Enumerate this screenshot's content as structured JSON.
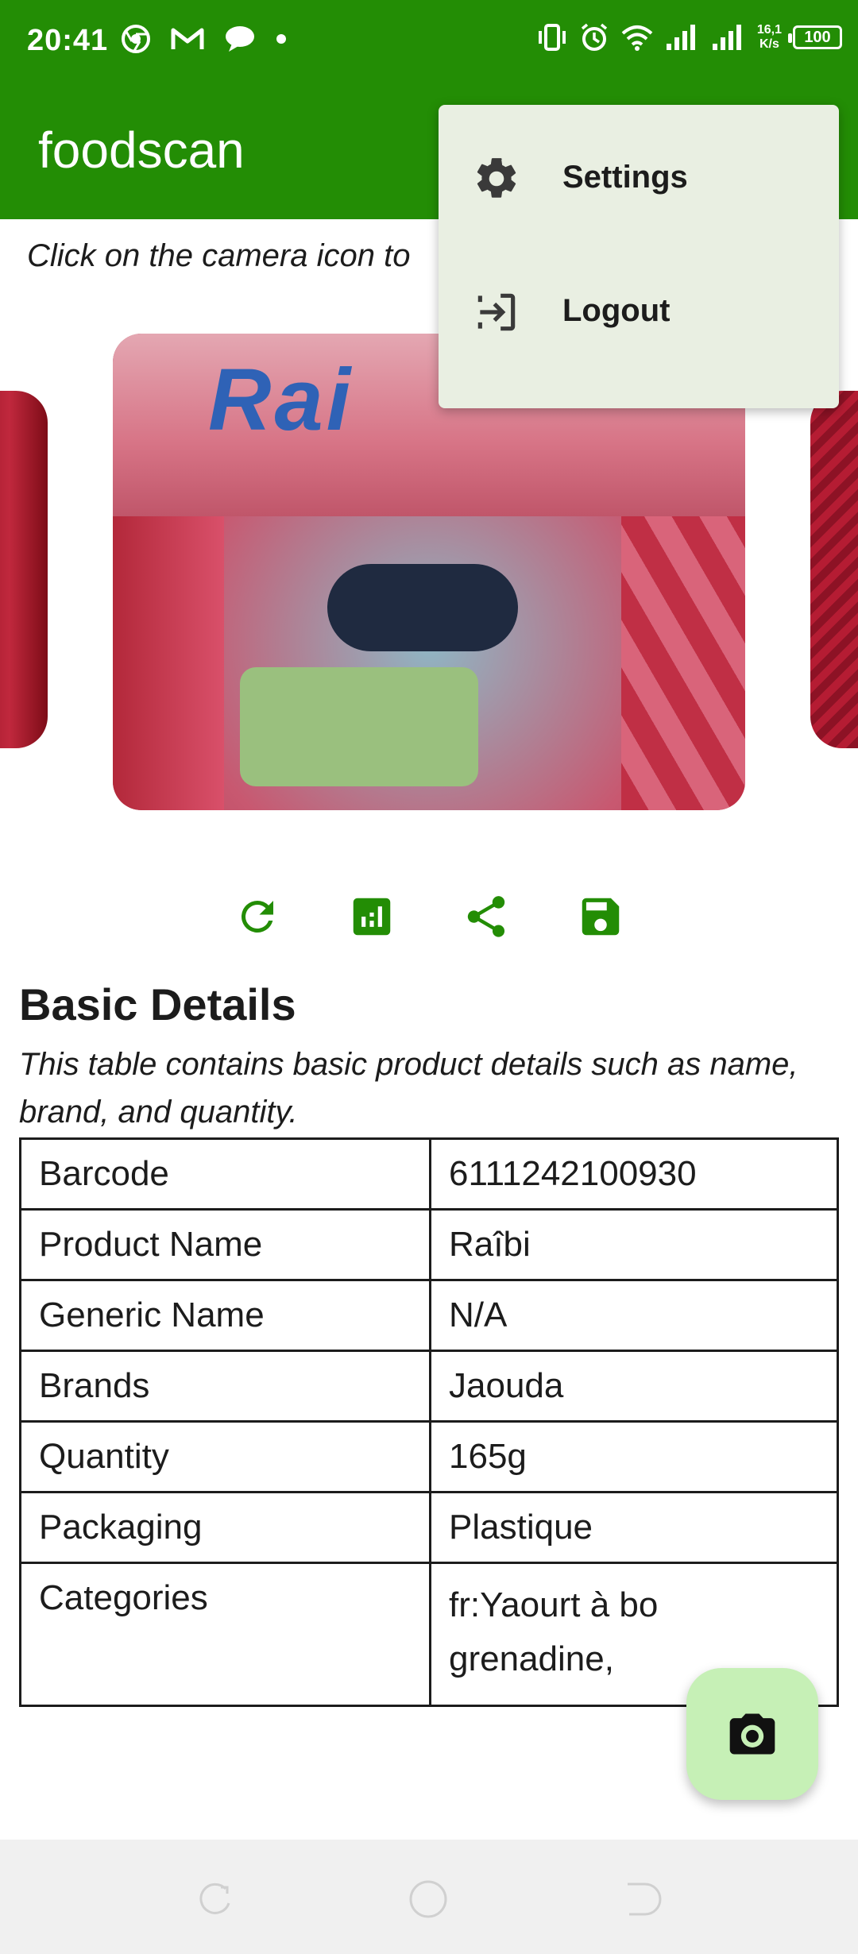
{
  "status_bar": {
    "time": "20:41",
    "speed_top": "16,1",
    "speed_bottom": "K/s",
    "battery": "100",
    "icons_left": [
      "chrome-icon",
      "gmail-icon",
      "chat-bubble-icon",
      "dot-icon"
    ],
    "icons_right": [
      "vibrate-icon",
      "alarm-icon",
      "wifi-icon",
      "signal-icon",
      "signal-icon"
    ]
  },
  "app_bar": {
    "title": "foodscan",
    "color": "#238d05"
  },
  "menu": {
    "items": [
      {
        "label": "Settings",
        "icon": "gear-icon"
      },
      {
        "label": "Logout",
        "icon": "logout-icon"
      }
    ]
  },
  "main": {
    "hint": "Click on the camera icon to",
    "actions": [
      "refresh-icon",
      "chart-icon",
      "share-icon",
      "save-icon"
    ],
    "section": {
      "title": "Basic Details",
      "description": "This table contains basic product details such as name, brand, and quantity."
    },
    "table": {
      "rows": [
        {
          "key": "Barcode",
          "value": "6111242100930"
        },
        {
          "key": "Product Name",
          "value": "Raîbi"
        },
        {
          "key": "Generic Name",
          "value": "N/A"
        },
        {
          "key": "Brands",
          "value": "Jaouda"
        },
        {
          "key": "Quantity",
          "value": "165g"
        },
        {
          "key": "Packaging",
          "value": "Plastique"
        },
        {
          "key": "Categories",
          "value": "fr:Yaourt à bo grenadine,"
        }
      ]
    },
    "image_text": "Rai"
  },
  "fab": {
    "icon": "camera-icon",
    "color": "#c6f0b6"
  }
}
